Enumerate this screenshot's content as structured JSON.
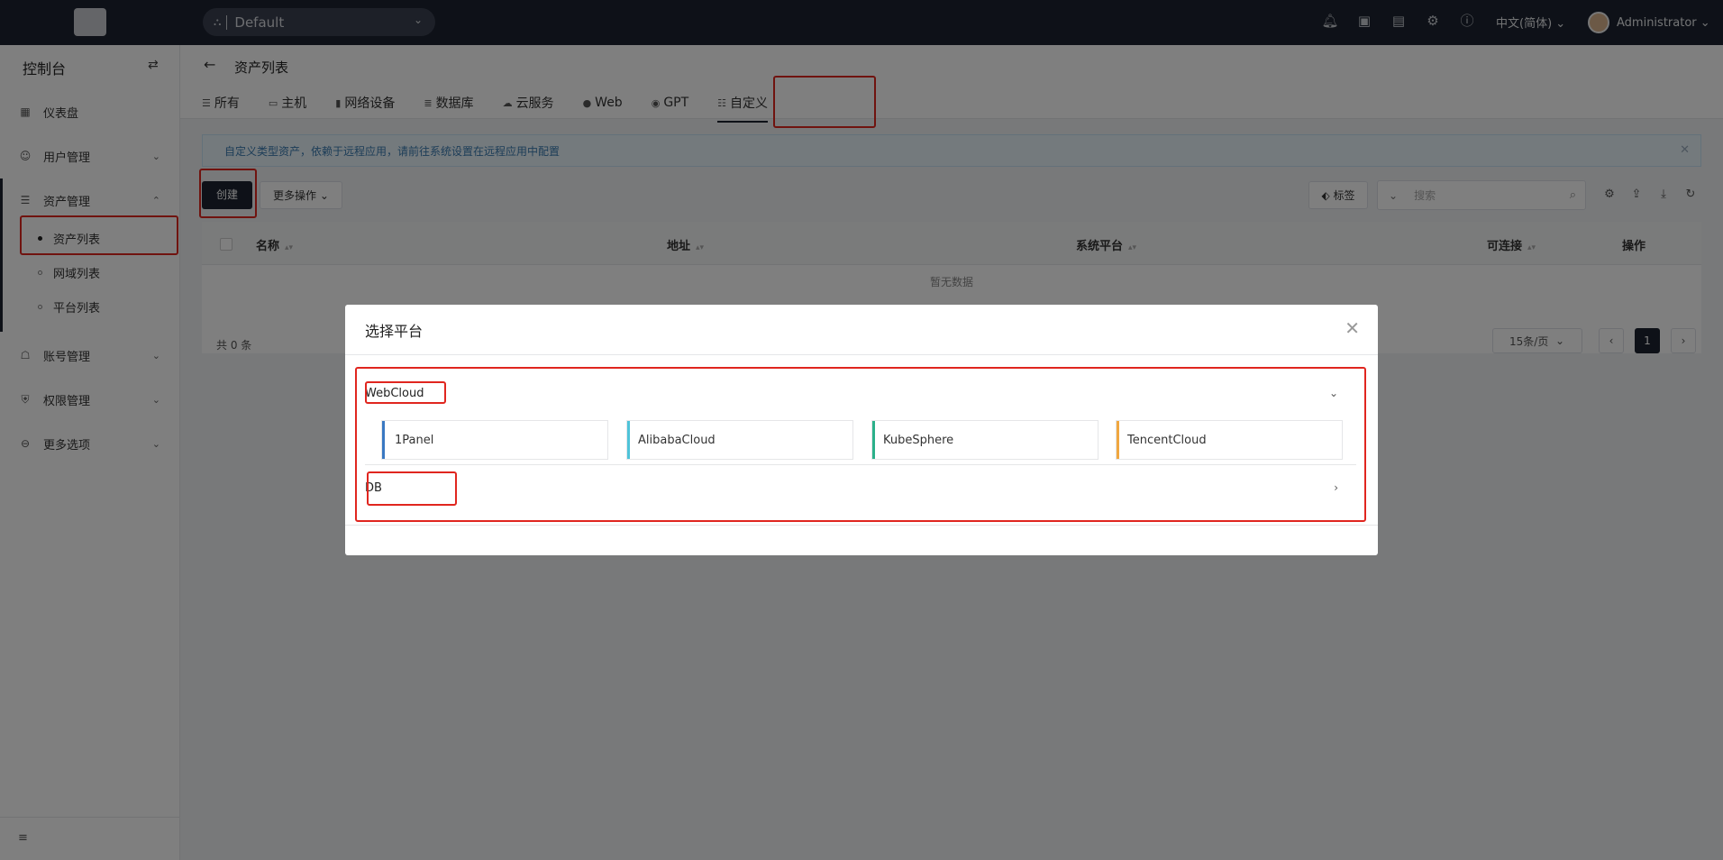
{
  "topbar": {
    "org_name": "Default",
    "language": "中文(简体)",
    "user_name": "Administrator"
  },
  "sidebar": {
    "title": "控制台",
    "items": [
      {
        "label": "仪表盘"
      },
      {
        "label": "用户管理"
      },
      {
        "label": "资产管理"
      },
      {
        "label": "账号管理"
      },
      {
        "label": "权限管理"
      },
      {
        "label": "更多选项"
      }
    ],
    "asset_sub": [
      {
        "label": "资产列表"
      },
      {
        "label": "网域列表"
      },
      {
        "label": "平台列表"
      }
    ]
  },
  "page": {
    "title": "资产列表",
    "tabs": [
      {
        "label": "所有"
      },
      {
        "label": "主机"
      },
      {
        "label": "网络设备"
      },
      {
        "label": "数据库"
      },
      {
        "label": "云服务"
      },
      {
        "label": "Web"
      },
      {
        "label": "GPT"
      },
      {
        "label": "自定义"
      }
    ],
    "alert": "自定义类型资产，依赖于远程应用，请前往系统设置在远程应用中配置",
    "create_label": "创建",
    "more_label": "更多操作",
    "tag_label": "标签",
    "search_placeholder": "搜索",
    "columns": [
      "名称",
      "地址",
      "系统平台",
      "可连接",
      "操作"
    ],
    "empty_text": "暂无数据",
    "total_text": "共 0 条",
    "page_size": "15条/页",
    "current_page": "1"
  },
  "modal": {
    "title": "选择平台",
    "groups": [
      {
        "name": "WebCloud",
        "platforms": [
          {
            "name": "1Panel",
            "color": "#3a78c2"
          },
          {
            "name": "AlibabaCloud",
            "color": "#4fc3d9"
          },
          {
            "name": "KubeSphere",
            "color": "#2bb08a"
          },
          {
            "name": "TencentCloud",
            "color": "#f0a740"
          }
        ]
      },
      {
        "name": "DB"
      }
    ]
  },
  "colors": {
    "highlight": "#e0261f",
    "nav_bg": "#1c2330"
  }
}
